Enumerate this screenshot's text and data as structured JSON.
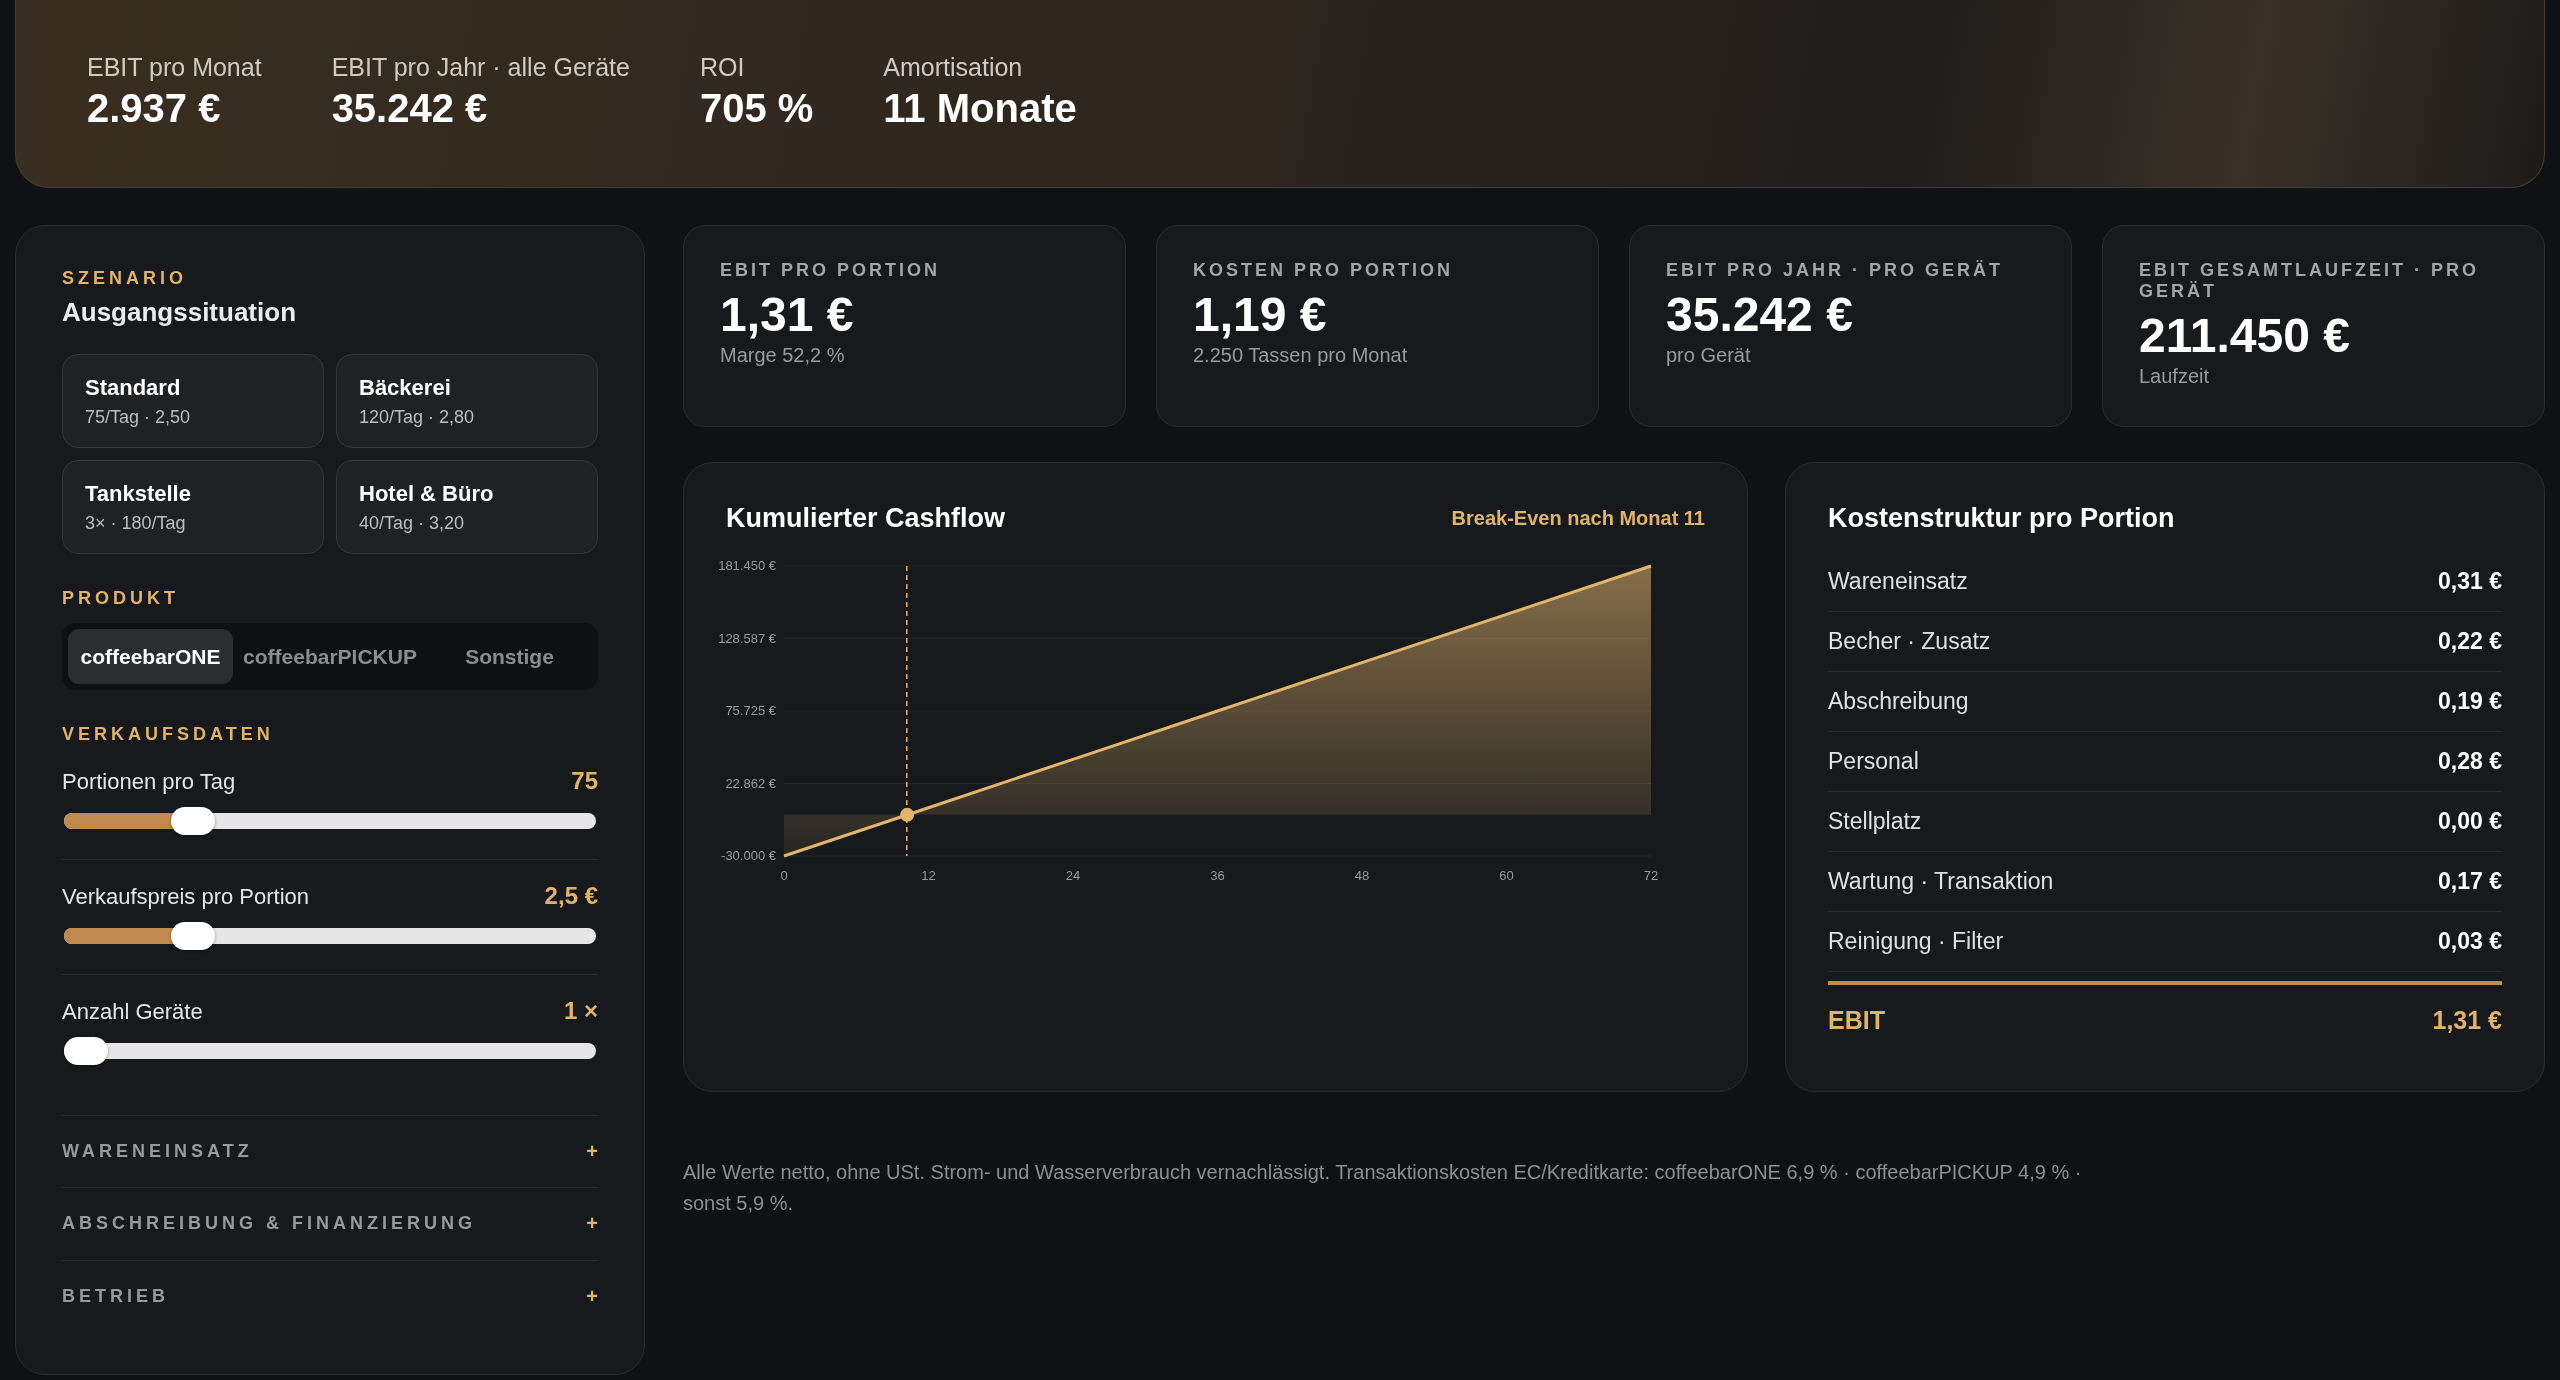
{
  "summary": [
    {
      "label": "EBIT pro Monat",
      "value": "2.937 €"
    },
    {
      "label": "EBIT pro Jahr · alle Geräte",
      "value": "35.242 €"
    },
    {
      "label": "ROI",
      "value": "705 %"
    },
    {
      "label": "Amortisation",
      "value": "11 Monate"
    }
  ],
  "sidebar": {
    "scenario_heading": "SZENARIO",
    "scenario_title": "Ausgangssituation",
    "scenarios": [
      {
        "name": "Standard",
        "detail": "75/Tag · 2,50",
        "selected": false
      },
      {
        "name": "Bäckerei",
        "detail": "120/Tag · 2,80",
        "selected": false
      },
      {
        "name": "Tankstelle",
        "detail": "3× · 180/Tag",
        "selected": false
      },
      {
        "name": "Hotel & Büro",
        "detail": "40/Tag · 3,20",
        "selected": false
      }
    ],
    "product_heading": "PRODUKT",
    "products": [
      {
        "label": "coffeebarONE",
        "selected": true
      },
      {
        "label": "coffeebarPICKUP",
        "selected": false
      },
      {
        "label": "Sonstige",
        "selected": false
      }
    ],
    "sales_heading": "VERKAUFSDATEN",
    "sliders": [
      {
        "label": "Portionen pro Tag",
        "reading": "75",
        "level": 0.22
      },
      {
        "label": "Verkaufspreis pro Portion",
        "reading": "2,5 €",
        "level": 0.22
      },
      {
        "label": "Anzahl Geräte",
        "reading": "1 ×",
        "level": 0
      }
    ],
    "sections": [
      {
        "label": "WARENEINSATZ",
        "toggle": "+",
        "expanded": false
      },
      {
        "label": "ABSCHREIBUNG & FINANZIERUNG",
        "toggle": "+",
        "expanded": false
      },
      {
        "label": "BETRIEB",
        "toggle": "+",
        "expanded": false
      }
    ]
  },
  "kpis": [
    {
      "label": "EBIT PRO PORTION",
      "value": "1,31 €",
      "note": "Marge 52,2 %"
    },
    {
      "label": "KOSTEN PRO PORTION",
      "value": "1,19 €",
      "note": "2.250 Tassen pro Monat"
    },
    {
      "label": "EBIT PRO JAHR · PRO GERÄT",
      "value": "35.242 €",
      "note": "pro Gerät"
    },
    {
      "label": "EBIT GESAMTLAUFZEIT · PRO GERÄT",
      "value": "211.450 €",
      "note": "Laufzeit"
    }
  ],
  "cashflow": {
    "title": "Kumulierter Cashflow",
    "break_even": "Break-Even nach Monat 11",
    "chart_data": {
      "type": "area",
      "x": [
        0,
        12,
        24,
        36,
        48,
        60,
        72
      ],
      "series": [
        {
          "color": "#e2b46c",
          "values": [
            -30000,
            5200,
            40500,
            75700,
            111000,
            146200,
            181450
          ]
        }
      ],
      "xlim": [
        0,
        72
      ],
      "ylim": [
        -30000,
        181450
      ],
      "xticks": [
        0,
        12,
        24,
        36,
        48,
        60,
        72
      ],
      "yticks": [
        {
          "value": -30000,
          "label": "-30.000 €"
        },
        {
          "value": 22862,
          "label": "22.862 €"
        },
        {
          "value": 75725,
          "label": "75.725 €"
        },
        {
          "value": 128587,
          "label": "128.587 €"
        },
        {
          "value": 181450,
          "label": "181.450 €"
        }
      ],
      "grid": true,
      "ref_lines": [
        {
          "axis": "x",
          "value": 10.2
        }
      ]
    }
  },
  "costs": {
    "title": "Kostenstruktur pro Portion",
    "rows": [
      {
        "label": "Wareneinsatz",
        "value": "0,31 €"
      },
      {
        "label": "Becher · Zusatz",
        "value": "0,22 €"
      },
      {
        "label": "Abschreibung",
        "value": "0,19 €"
      },
      {
        "label": "Personal",
        "value": "0,28 €"
      },
      {
        "label": "Stellplatz",
        "value": "0,00 €"
      },
      {
        "label": "Wartung · Transaktion",
        "value": "0,17 €"
      },
      {
        "label": "Reinigung · Filter",
        "value": "0,03 €"
      }
    ],
    "total": {
      "label": "EBIT",
      "value": "1,31 €"
    }
  },
  "footnote": "Alle Werte netto, ohne USt. Strom- und Wasserverbrauch vernachlässigt. Transaktionskosten EC/Kreditkarte: coffeebarONE 6,9 % · coffeebarPICKUP 4,9 % · sonst 5,9 %."
}
